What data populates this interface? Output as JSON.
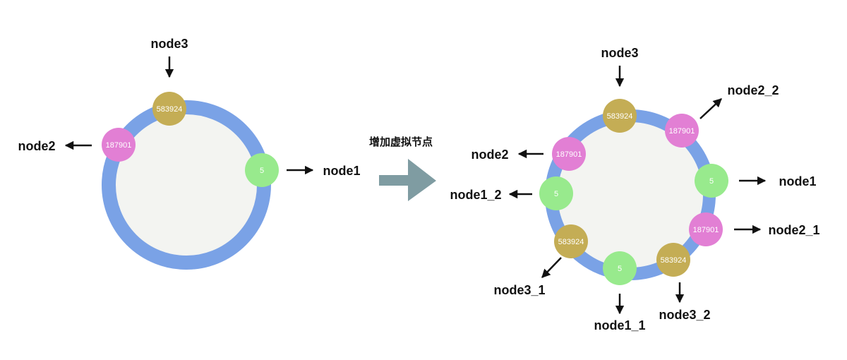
{
  "colors": {
    "ring": "#7aa2e6",
    "ring_fill": "#f3f4f1",
    "node_583924": "#c4ad55",
    "node_187901": "#e27fd4",
    "node_5": "#98ea8d",
    "arrow": "#111111",
    "big_arrow": "#7f9ca2"
  },
  "caption": "增加虚拟节点",
  "left_ring": {
    "nodes": [
      {
        "id": "n3",
        "hash": "583924",
        "color_key": "node_583924",
        "label": "node3"
      },
      {
        "id": "n2",
        "hash": "187901",
        "color_key": "node_187901",
        "label": "node2"
      },
      {
        "id": "n1",
        "hash": "5",
        "color_key": "node_5",
        "label": "node1"
      }
    ]
  },
  "right_ring": {
    "nodes": [
      {
        "id": "r_n3",
        "hash": "583924",
        "color_key": "node_583924",
        "label": "node3"
      },
      {
        "id": "r_n2_2",
        "hash": "187901",
        "color_key": "node_187901",
        "label": "node2_2"
      },
      {
        "id": "r_n2",
        "hash": "187901",
        "color_key": "node_187901",
        "label": "node2"
      },
      {
        "id": "r_n1",
        "hash": "5",
        "color_key": "node_5",
        "label": "node1"
      },
      {
        "id": "r_n1_2",
        "hash": "5",
        "color_key": "node_5",
        "label": "node1_2"
      },
      {
        "id": "r_n2_1",
        "hash": "187901",
        "color_key": "node_187901",
        "label": "node2_1"
      },
      {
        "id": "r_n3_1",
        "hash": "583924",
        "color_key": "node_583924",
        "label": "node3_1"
      },
      {
        "id": "r_n3_2",
        "hash": "583924",
        "color_key": "node_583924",
        "label": "node3_2"
      },
      {
        "id": "r_n1_1",
        "hash": "5",
        "color_key": "node_5",
        "label": "node1_1"
      }
    ]
  }
}
